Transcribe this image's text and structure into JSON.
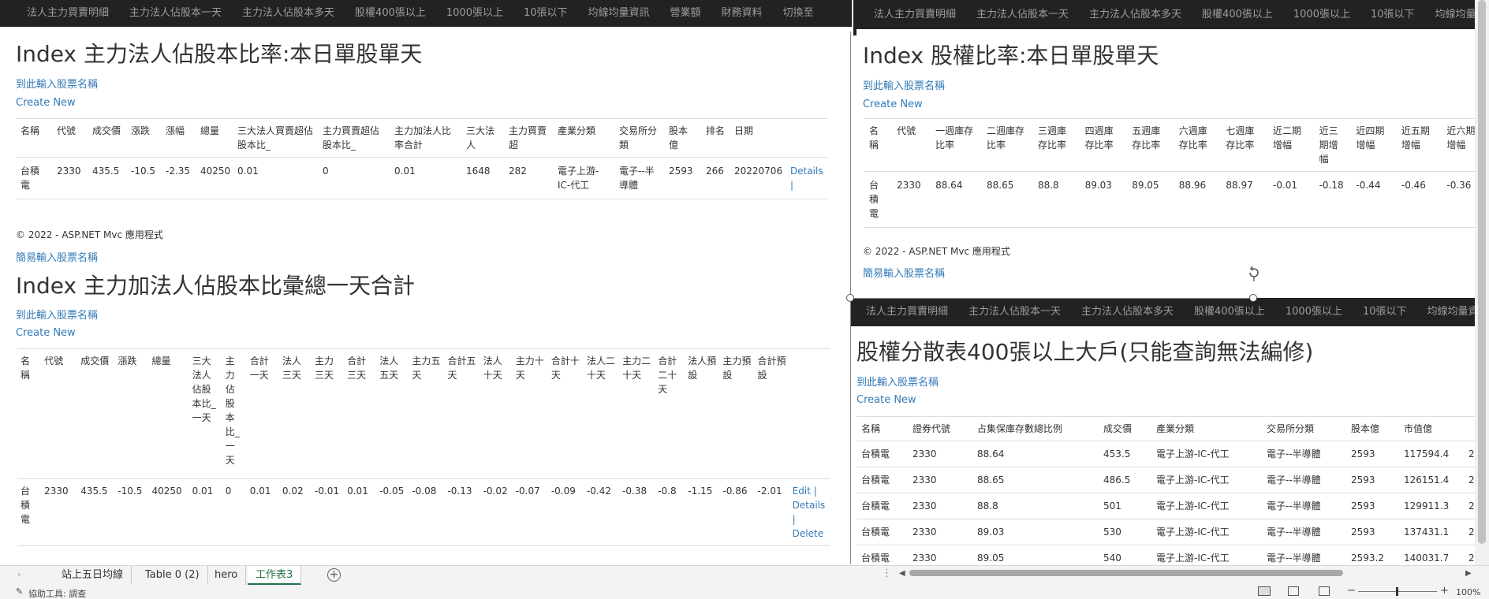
{
  "navbar_items": [
    "法人主力買賣明細",
    "主力法人佔股本一天",
    "主力法人佔股本多天",
    "股權400張以上",
    "1000張以上",
    "10張以下",
    "均線均量資訊",
    "營業額",
    "財務資料",
    "切換至"
  ],
  "navbar_right_items": [
    "法人主力買賣明細",
    "主力法人佔股本一天",
    "主力法人佔股本多天",
    "股權400張以上",
    "1000張以上",
    "10張以下",
    "均線均量資訊"
  ],
  "navbar_sub_items": [
    "法人主力買賣明細",
    "主力法人佔股本一天",
    "主力法人佔股本多天",
    "股權400張以上",
    "1000張以上",
    "10張以下",
    "均線均量資訊"
  ],
  "panel_a": {
    "title": "Index 主力法人佔股本比率:本日單股單天",
    "input_link": "到此輸入股票名稱",
    "create_link": "Create New",
    "headers": [
      "名稱",
      "代號",
      "成交價",
      "漲跌",
      "漲幅",
      "總量",
      "三大法人買賣超佔股本比_",
      "主力買賣超佔股本比_",
      "主力加法人比率合計",
      "三大法人",
      "主力買賣超",
      "產業分類",
      "交易所分類",
      "股本億",
      "排名",
      "日期",
      ""
    ],
    "rows": [
      [
        "台積電",
        "2330",
        "435.5",
        "-10.5",
        "-2.35",
        "40250",
        "0.01",
        "0",
        "0.01",
        "1648",
        "282",
        "電子上游-IC-代工",
        "電子--半導體",
        "2593",
        "266",
        "20220706",
        "Details |"
      ]
    ],
    "footer": "© 2022 - ASP.NET Mvc 應用程式",
    "footer_link": "簡易輸入股票名稱"
  },
  "panel_b": {
    "title": "Index 主力加法人佔股本比彙總一天合計",
    "input_link": "到此輸入股票名稱",
    "create_link": "Create New",
    "headers": [
      "名稱",
      "代號",
      "成交價",
      "漲跌",
      "總量",
      "三大法人佔股本比_一天",
      "主力佔股本比_一天",
      "合計一天",
      "法人三天",
      "主力三天",
      "合計三天",
      "法人五天",
      "主力五天",
      "合計五天",
      "法人十天",
      "主力十天",
      "合計十天",
      "法人二十天",
      "主力二十天",
      "合計二十天",
      "法人預設",
      "主力預設",
      "合計預設",
      ""
    ],
    "rows": [
      [
        "台積電",
        "2330",
        "435.5",
        "-10.5",
        "40250",
        "0.01",
        "0",
        "0.01",
        "0.02",
        "-0.01",
        "0.01",
        "-0.05",
        "-0.08",
        "-0.13",
        "-0.02",
        "-0.07",
        "-0.09",
        "-0.42",
        "-0.38",
        "-0.8",
        "-1.15",
        "-0.86",
        "-2.01"
      ]
    ],
    "row_actions": [
      "Edit |",
      "Details |",
      "Delete"
    ]
  },
  "panel_c": {
    "title": "Index 股權比率:本日單股單天",
    "input_link": "到此輸入股票名稱",
    "create_link": "Create New",
    "headers": [
      "名稱",
      "代號",
      "一週庫存比率",
      "二週庫存比率",
      "三週庫存比率",
      "四週庫存比率",
      "五週庫存比率",
      "六週庫存比率",
      "七週庫存比率",
      "近二期增幅",
      "近三期增幅",
      "近四期增幅",
      "近五期增幅",
      "近六期增幅"
    ],
    "rows": [
      [
        "台積電",
        "2330",
        "88.64",
        "88.65",
        "88.8",
        "89.03",
        "89.05",
        "88.96",
        "88.97",
        "-0.01",
        "-0.18",
        "-0.44",
        "-0.46",
        "-0.36"
      ]
    ],
    "footer": "© 2022 - ASP.NET Mvc 應用程式",
    "footer_link": "簡易輸入股票名稱"
  },
  "panel_d": {
    "title": "股權分散表400張以上大戶(只能查詢無法編修)",
    "input_link": "到此輸入股票名稱",
    "create_link": "Create New",
    "headers": [
      "名稱",
      "證券代號",
      "占集保庫存數總比例",
      "成交價",
      "產業分類",
      "交易所分類",
      "股本億",
      "市值億",
      ""
    ],
    "rows": [
      [
        "台積電",
        "2330",
        "88.64",
        "453.5",
        "電子上游-IC-代工",
        "電子--半導體",
        "2593",
        "117594.4",
        "2"
      ],
      [
        "台積電",
        "2330",
        "88.65",
        "486.5",
        "電子上游-IC-代工",
        "電子--半導體",
        "2593",
        "126151.4",
        "2"
      ],
      [
        "台積電",
        "2330",
        "88.8",
        "501",
        "電子上游-IC-代工",
        "電子--半導體",
        "2593",
        "129911.3",
        "2"
      ],
      [
        "台積電",
        "2330",
        "89.03",
        "530",
        "電子上游-IC-代工",
        "電子--半導體",
        "2593",
        "137431.1",
        "2"
      ],
      [
        "台積電",
        "2330",
        "89.05",
        "540",
        "電子上游-IC-代工",
        "電子--半導體",
        "2593.2",
        "140031.7",
        "2"
      ]
    ]
  },
  "sheet_tabs": [
    "站上五日均線",
    "Table 0 (2)",
    "hero",
    "工作表3"
  ],
  "active_sheet": "工作表3",
  "status_text": "協助工具: 調查",
  "zoom": "100%"
}
